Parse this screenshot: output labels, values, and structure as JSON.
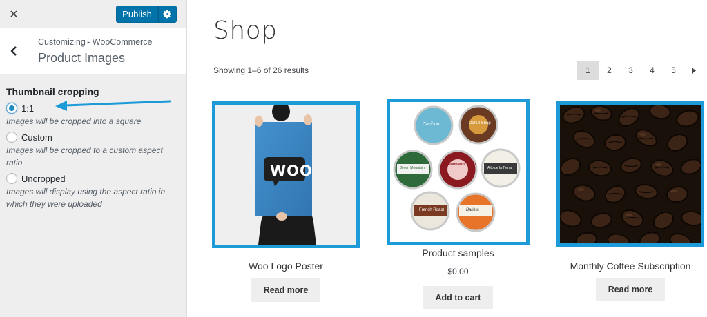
{
  "sidebar": {
    "close_icon": "close-icon",
    "publish_label": "Publish",
    "settings_icon": "gear-icon",
    "back_icon": "chevron-left-icon",
    "breadcrumb_parent": "Customizing",
    "breadcrumb_child": "WooCommerce",
    "section_title": "Product Images",
    "panel_title": "Thumbnail cropping",
    "options": [
      {
        "label": "1:1",
        "checked": true,
        "description": "Images will be cropped into a square"
      },
      {
        "label": "Custom",
        "checked": false,
        "description": "Images will be cropped to a custom aspect ratio"
      },
      {
        "label": "Uncropped",
        "checked": false,
        "description": "Images will display using the aspect ratio in which they were uploaded"
      }
    ]
  },
  "shop": {
    "title": "Shop",
    "result_count": "Showing 1–6 of 26 results",
    "pagination": {
      "pages": [
        "1",
        "2",
        "3",
        "4",
        "5"
      ],
      "current": "1",
      "next_icon": "triangle-right-icon"
    },
    "products": [
      {
        "name": "Woo Logo Poster",
        "price": "",
        "button": "Read more",
        "image_logo_text": "WOO"
      },
      {
        "name": "Product samples",
        "price": "$0.00",
        "button": "Add to cart",
        "pod_labels": [
          "Caribou",
          "Donut Shop",
          "Green Mountain",
          "Newman's Own",
          "Alto de la Tierra",
          "French Roast",
          "Barista"
        ]
      },
      {
        "name": "Monthly Coffee Subscription",
        "price": "",
        "button": "Read more"
      }
    ]
  },
  "colors": {
    "accent": "#1d9ad8",
    "publish": "#0073aa",
    "annotation_arrow": "#1d9ad8"
  }
}
